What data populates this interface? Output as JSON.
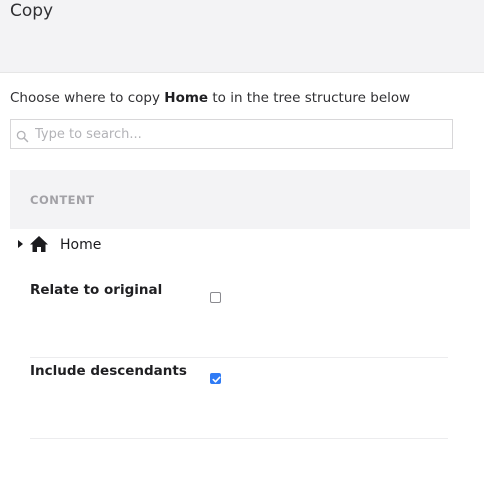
{
  "dialog": {
    "title": "Copy",
    "intro_prefix": "Choose where to copy ",
    "intro_target": "Home",
    "intro_suffix": " to in the tree structure below"
  },
  "search": {
    "placeholder": "Type to search...",
    "value": "",
    "icon": "search-icon"
  },
  "tree": {
    "section_label": "CONTENT",
    "nodes": [
      {
        "label": "Home",
        "icon": "home-icon",
        "expanded": false
      }
    ]
  },
  "options": [
    {
      "label": "Relate to original",
      "checked": false
    },
    {
      "label": "Include descendants",
      "checked": true
    }
  ],
  "colors": {
    "accent": "#2f7bf5",
    "header_bg": "#f3f3f5"
  }
}
